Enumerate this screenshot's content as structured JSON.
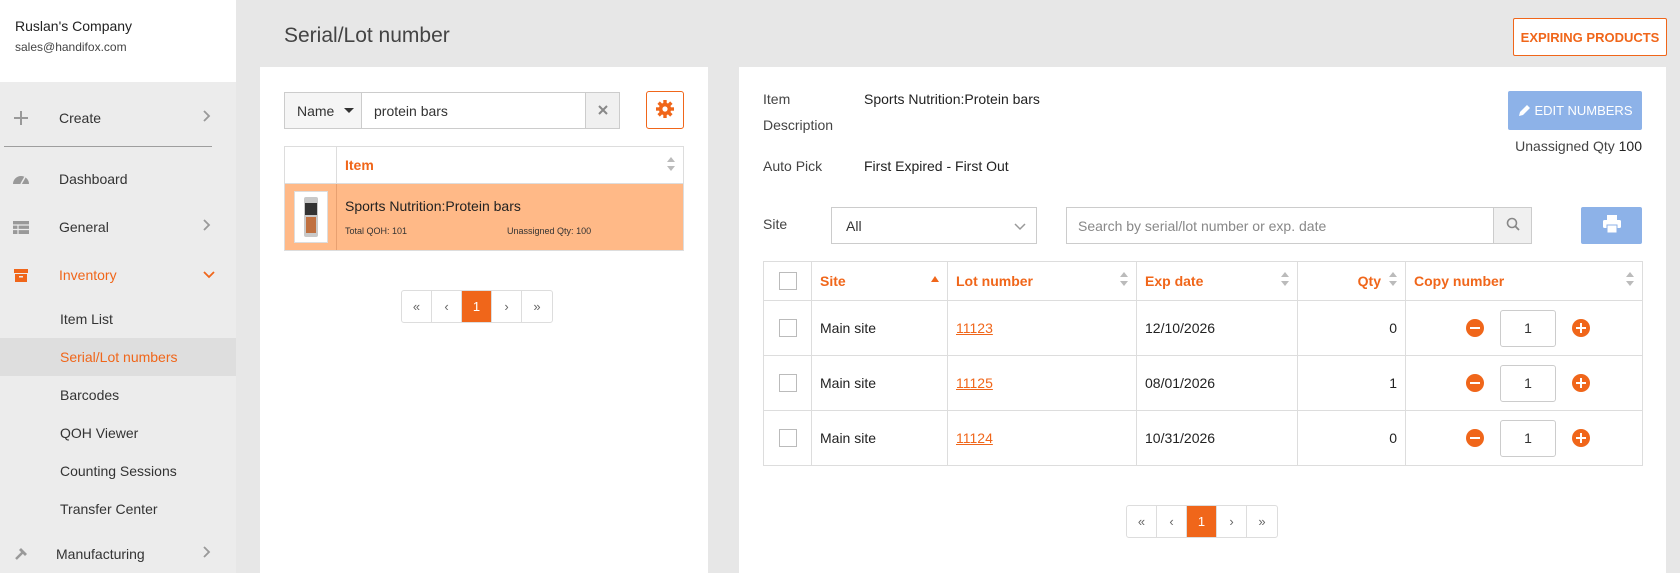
{
  "company": {
    "name": "Ruslan's Company",
    "email": "sales@handifox.com"
  },
  "nav": {
    "create": "Create",
    "dashboard": "Dashboard",
    "general": "General",
    "inventory": "Inventory",
    "manufacturing": "Manufacturing",
    "inventory_items": [
      "Item List",
      "Serial/Lot numbers",
      "Barcodes",
      "QOH Viewer",
      "Counting Sessions",
      "Transfer Center"
    ]
  },
  "page": {
    "title": "Serial/Lot number",
    "expiring_button": "EXPIRING PRODUCTS"
  },
  "left": {
    "search_type": "Name",
    "search_value": "protein bars",
    "table_header": "Item",
    "item": {
      "name": "Sports Nutrition:Protein bars",
      "total_qoh_label": "Total QOH:",
      "total_qoh": "101",
      "unassigned_label": "Unassigned Qty:",
      "unassigned": "100"
    },
    "pager": {
      "first": "«",
      "prev": "‹",
      "page": "1",
      "next": "›",
      "last": "»"
    }
  },
  "right": {
    "item_label": "Item",
    "item_value": "Sports Nutrition:Protein bars",
    "description_label": "Description",
    "autopick_label": "Auto Pick",
    "autopick_value": "First Expired - First Out",
    "edit_button": "EDIT NUMBERS",
    "unassigned_label": "Unassigned Qty",
    "unassigned_value": "100",
    "site_label": "Site",
    "site_value": "All",
    "search_placeholder": "Search by serial/lot number or exp. date",
    "columns": {
      "site": "Site",
      "lot": "Lot number",
      "exp": "Exp date",
      "qty": "Qty",
      "copy": "Copy number"
    },
    "rows": [
      {
        "site": "Main site",
        "lot": "11123",
        "exp": "12/10/2026",
        "qty": "0",
        "copy": "1"
      },
      {
        "site": "Main site",
        "lot": "11125",
        "exp": "08/01/2026",
        "qty": "1",
        "copy": "1"
      },
      {
        "site": "Main site",
        "lot": "11124",
        "exp": "10/31/2026",
        "qty": "0",
        "copy": "1"
      }
    ],
    "pager": {
      "first": "«",
      "prev": "‹",
      "page": "1",
      "next": "›",
      "last": "»"
    }
  },
  "colors": {
    "accent": "#f0661a",
    "selected_row": "#ffb987",
    "disabled_button": "#8db2e8"
  }
}
